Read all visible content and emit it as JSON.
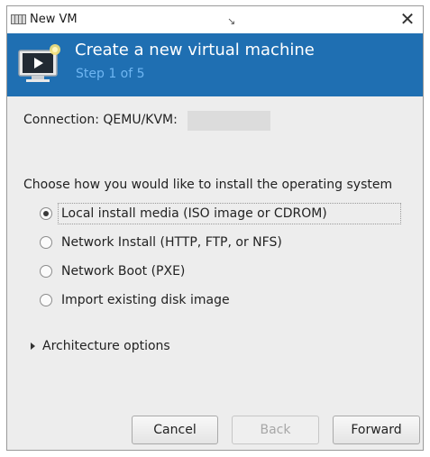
{
  "window": {
    "title": "New VM",
    "close_glyph": "✕"
  },
  "banner": {
    "title": "Create a new virtual machine",
    "step": "Step 1 of 5",
    "icon": "virtual-machine-monitor-icon",
    "background": "#1f6fb2"
  },
  "connection": {
    "label": "Connection: QEMU/KVM:"
  },
  "install": {
    "question": "Choose how you would like to install the operating system",
    "options": [
      {
        "label": "Local install media (ISO image or CDROM)",
        "selected": true
      },
      {
        "label": "Network Install (HTTP, FTP, or NFS)",
        "selected": false
      },
      {
        "label": "Network Boot (PXE)",
        "selected": false
      },
      {
        "label": "Import existing disk image",
        "selected": false
      }
    ]
  },
  "architecture": {
    "label": "Architecture options",
    "expanded": false
  },
  "buttons": {
    "cancel": "Cancel",
    "back": "Back",
    "forward": "Forward",
    "back_enabled": false
  }
}
